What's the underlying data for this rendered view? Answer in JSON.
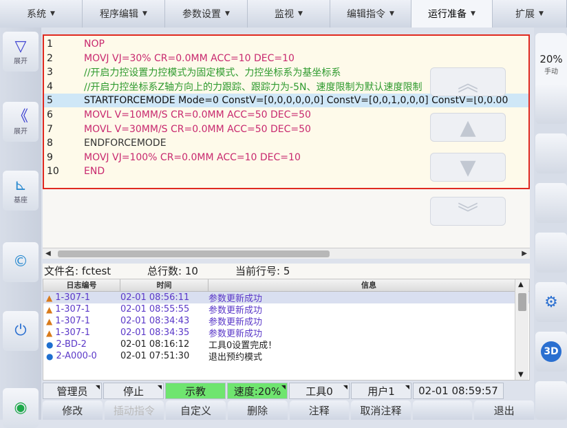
{
  "menu": [
    {
      "label": "系统",
      "width": 120,
      "active": false
    },
    {
      "label": "程序编辑",
      "width": 120,
      "active": false
    },
    {
      "label": "参数设置",
      "width": 120,
      "active": false
    },
    {
      "label": "监视",
      "width": 120,
      "active": false
    },
    {
      "label": "编辑指令",
      "width": 118,
      "active": false
    },
    {
      "label": "运行准备",
      "width": 118,
      "active": true
    },
    {
      "label": "扩展",
      "width": 108,
      "active": false
    }
  ],
  "left_buttons": [
    {
      "icon": "▽",
      "label": "展开"
    },
    {
      "icon": "《",
      "label": "展开"
    },
    {
      "icon": "⊾",
      "label": "基座"
    },
    {
      "icon": "©",
      "label": ""
    },
    {
      "icon": "⏻",
      "label": ""
    },
    {
      "icon": "◉",
      "label": ""
    }
  ],
  "right": {
    "speed": "20%",
    "mode": "手动"
  },
  "code_lines": [
    {
      "n": "1",
      "text": "NOP",
      "color": "#c8286e"
    },
    {
      "n": "2",
      "text": "MOVJ VJ=30% CR=0.0MM ACC=10 DEC=10",
      "color": "#c8286e"
    },
    {
      "n": "3",
      "text": "//开启力控设置力控模式为固定模式、力控坐标系为基坐标系",
      "color": "#2e9a2e"
    },
    {
      "n": "4",
      "text": "//开启力控坐标系Z轴方向上的力跟踪、跟踪力为-5N、速度限制为默认速度限制",
      "color": "#2e9a2e"
    },
    {
      "n": "5",
      "text": "STARTFORCEMODE Mode=0 ConstV=[0,0,0,0,0,0] ConstV=[0,0,1,0,0,0] ConstV=[0,0.00",
      "color": "#111"
    },
    {
      "n": "6",
      "text": "MOVL V=10MM/S CR=0.0MM ACC=50 DEC=50",
      "color": "#c8286e"
    },
    {
      "n": "7",
      "text": "MOVL V=30MM/S CR=0.0MM ACC=50 DEC=50",
      "color": "#c8286e"
    },
    {
      "n": "8",
      "text": "ENDFORCEMODE",
      "color": "#333"
    },
    {
      "n": "9",
      "text": "MOVJ VJ=100% CR=0.0MM ACC=10 DEC=10",
      "color": "#c8286e"
    },
    {
      "n": "10",
      "text": "END",
      "color": "#c8286e"
    }
  ],
  "selected_line": 5,
  "file": {
    "name_label": "文件名: fctest",
    "total_label": "总行数: 10",
    "current_label": "当前行号: 5"
  },
  "log": {
    "headers": [
      "日志编号",
      "时间",
      "信息"
    ],
    "rows": [
      {
        "icon": "warn",
        "code": "1-307-1",
        "time": "02-01 08:56:11",
        "msg": "参数更新成功",
        "sel": true
      },
      {
        "icon": "warn",
        "code": "1-307-1",
        "time": "02-01 08:55:55",
        "msg": "参数更新成功",
        "sel": false
      },
      {
        "icon": "warn",
        "code": "1-307-1",
        "time": "02-01 08:34:43",
        "msg": "参数更新成功",
        "sel": false
      },
      {
        "icon": "warn",
        "code": "1-307-1",
        "time": "02-01 08:34:35",
        "msg": "参数更新成功",
        "sel": false
      },
      {
        "icon": "info",
        "code": "2-BD-2",
        "time": "02-01 08:16:12",
        "msg": "工具0设置完成！",
        "sel": false
      },
      {
        "icon": "info",
        "code": "2-A000-0",
        "time": "02-01 07:51:30",
        "msg": "退出预约模式",
        "sel": false
      }
    ]
  },
  "status": [
    {
      "label": "管理员",
      "width": 86,
      "green": false,
      "tri": true
    },
    {
      "label": "停止",
      "width": 88,
      "green": false,
      "tri": true
    },
    {
      "label": "示教",
      "width": 88,
      "green": true,
      "tri": false
    },
    {
      "label": "速度:20%",
      "width": 88,
      "green": true,
      "tri": true
    },
    {
      "label": "工具0",
      "width": 88,
      "green": false,
      "tri": true
    },
    {
      "label": "用户1",
      "width": 88,
      "green": false,
      "tri": true
    },
    {
      "label": "02-01 08:59:57",
      "width": 132,
      "green": false,
      "tri": false
    }
  ],
  "bottom": [
    {
      "label": "修改",
      "disabled": false
    },
    {
      "label": "插动指令",
      "disabled": true
    },
    {
      "label": "自定义",
      "disabled": false
    },
    {
      "label": "删除",
      "disabled": false
    },
    {
      "label": "注释",
      "disabled": false
    },
    {
      "label": "取消注释",
      "disabled": false
    },
    {
      "label": "",
      "disabled": false
    },
    {
      "label": "退出",
      "disabled": false
    }
  ]
}
